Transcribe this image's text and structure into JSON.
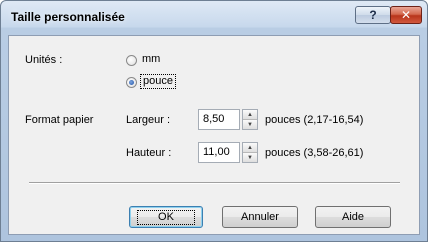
{
  "window": {
    "title": "Taille personnalisée",
    "help_glyph": "?",
    "close_glyph": "✕"
  },
  "units": {
    "label": "Unités :",
    "options": [
      {
        "label": "mm",
        "selected": false
      },
      {
        "label": "pouce",
        "selected": true
      }
    ]
  },
  "paper": {
    "label": "Format papier",
    "width": {
      "label": "Largeur :",
      "value": "8,50",
      "range": "pouces (2,17-16,54)"
    },
    "height": {
      "label": "Hauteur :",
      "value": "11,00",
      "range": "pouces (3,58-26,61)"
    }
  },
  "buttons": {
    "ok": "OK",
    "cancel": "Annuler",
    "help": "Aide"
  },
  "icons": {
    "spin_up": "▲",
    "spin_down": "▼"
  }
}
